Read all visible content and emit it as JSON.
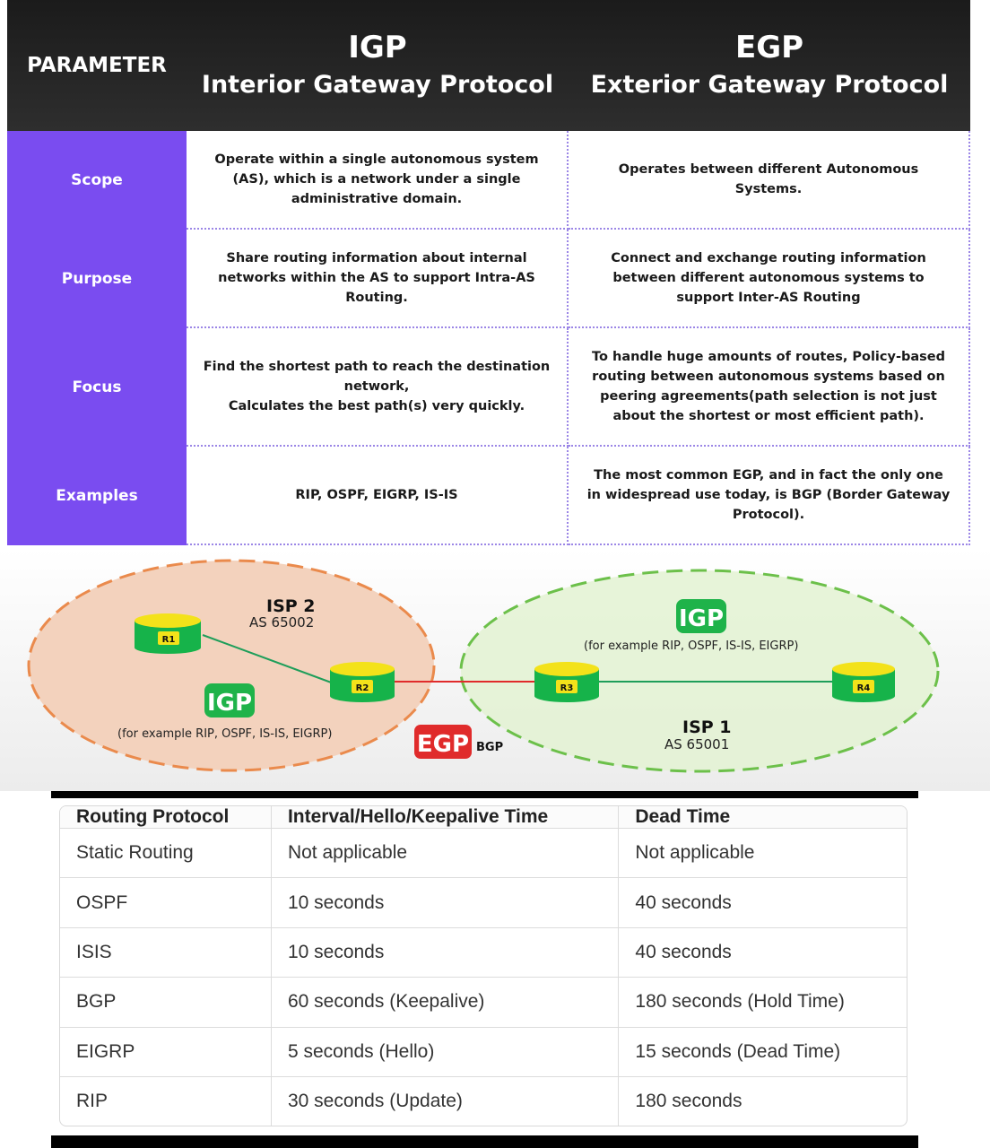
{
  "comparison": {
    "header": {
      "parameter": "PARAMETER",
      "igp_abbr": "IGP",
      "igp_full": "Interior Gateway Protocol",
      "egp_abbr": "EGP",
      "egp_full": "Exterior Gateway Protocol"
    },
    "rows": [
      {
        "param": "Scope",
        "igp": "Operate within a single autonomous system (AS), which is a network under a single administrative domain.",
        "egp": "Operates between different Autonomous Systems."
      },
      {
        "param": "Purpose",
        "igp": "Share routing information about internal networks within the AS to support Intra-AS Routing.",
        "egp": "Connect and exchange routing information between different autonomous systems to support Inter-AS Routing"
      },
      {
        "param": "Focus",
        "igp": "Find the shortest path to reach the destination network,\nCalculates the best path(s) very quickly.",
        "egp": "To handle huge amounts of routes, Policy-based routing between autonomous systems based on peering agreements(path selection is not just about the shortest or most efficient path)."
      },
      {
        "param": "Examples",
        "igp": "RIP, OSPF, EIGRP, IS-IS",
        "egp": "The most common EGP, and in fact the only one in widespread use today, is BGP (Border Gateway Protocol)."
      }
    ]
  },
  "diagram": {
    "isp2_name": "ISP 2",
    "isp2_as": "AS 65002",
    "isp1_name": "ISP 1",
    "isp1_as": "AS 65001",
    "igp_badge": "IGP",
    "igp_note": "(for example RIP, OSPF, IS-IS, EIGRP)",
    "egp_badge": "EGP",
    "egp_note": "BGP",
    "routers": [
      "R1",
      "R2",
      "R3",
      "R4"
    ],
    "colors": {
      "isp2_fill": "#f3d2bd",
      "isp2_border": "#ea8a4c",
      "isp1_fill": "#e3f2d2",
      "isp1_border": "#6cc04a",
      "router": "#16b34a",
      "router_top": "#f3e21a",
      "igp_badge": "#1fb34a",
      "egp_badge": "#e02b2b",
      "egp_link": "#e02b2b",
      "igp_link": "#1e9e5a"
    }
  },
  "timers": {
    "headers": [
      "Routing Protocol",
      "Interval/Hello/Keepalive Time",
      "Dead Time"
    ],
    "rows": [
      [
        "Static Routing",
        "Not applicable",
        "Not applicable"
      ],
      [
        "OSPF",
        "10 seconds",
        "40 seconds"
      ],
      [
        "ISIS",
        "10 seconds",
        "40 seconds"
      ],
      [
        "BGP",
        "60 seconds (Keepalive)",
        "180 seconds (Hold Time)"
      ],
      [
        "EIGRP",
        "5 seconds (Hello)",
        "15 seconds (Dead Time)"
      ],
      [
        "RIP",
        "30 seconds (Update)",
        "180 seconds"
      ]
    ]
  }
}
